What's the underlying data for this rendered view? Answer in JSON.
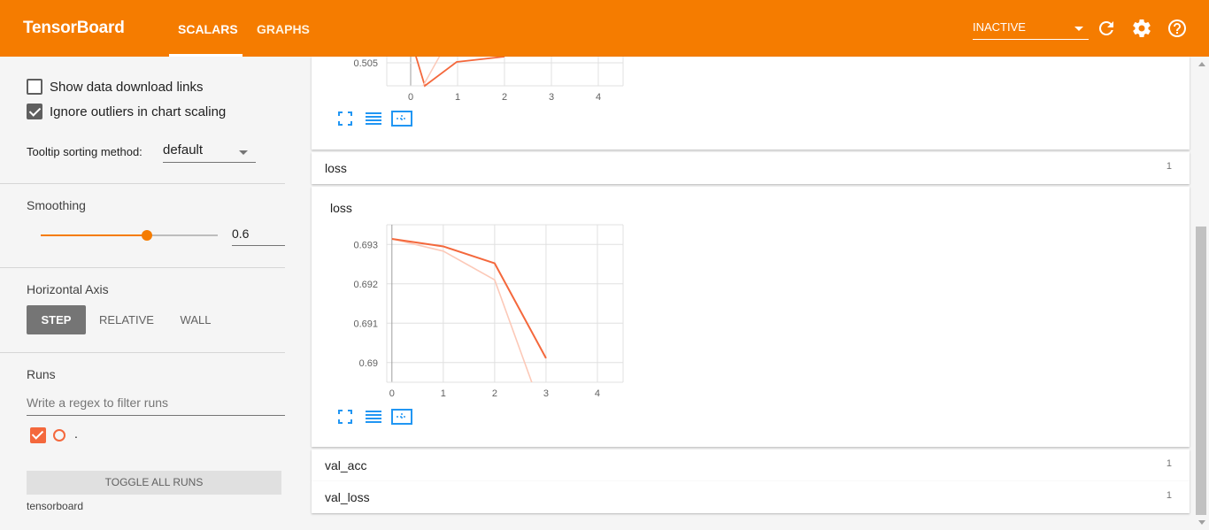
{
  "header": {
    "title": "TensorBoard",
    "tabs": [
      {
        "label": "SCALARS",
        "active": true
      },
      {
        "label": "GRAPHS",
        "active": false
      }
    ],
    "reload_status": "INACTIVE",
    "icons": [
      "refresh-icon",
      "settings-icon",
      "help-icon"
    ],
    "color": "#f57c00"
  },
  "sidebar": {
    "show_download_links": {
      "label": "Show data download links",
      "checked": false
    },
    "ignore_outliers": {
      "label": "Ignore outliers in chart scaling",
      "checked": true
    },
    "tooltip_sorting": {
      "label": "Tooltip sorting method:",
      "value": "default"
    },
    "smoothing": {
      "title": "Smoothing",
      "value": "0.6"
    },
    "horizontal_axis": {
      "title": "Horizontal Axis",
      "options": [
        "STEP",
        "RELATIVE",
        "WALL"
      ],
      "selected": "STEP"
    },
    "runs": {
      "title": "Runs",
      "filter_placeholder": "Write a regex to filter runs",
      "items": [
        {
          "name": ".",
          "checked": true,
          "color": "#f4683c"
        }
      ]
    },
    "toggle_all_label": "TOGGLE ALL RUNS",
    "footer": "tensorboard"
  },
  "main": {
    "acc_chart_fragment": {
      "y_tick": "0.505",
      "x_ticks": [
        "0",
        "1",
        "2",
        "3",
        "4"
      ]
    },
    "categories": [
      {
        "name": "loss",
        "count": "1"
      },
      {
        "name": "val_acc",
        "count": "1"
      },
      {
        "name": "val_loss",
        "count": "1"
      }
    ],
    "loss_chart": {
      "title": "loss"
    }
  },
  "chart_data": {
    "type": "line",
    "title": "loss",
    "x": [
      0,
      1,
      2,
      3
    ],
    "xlim": [
      -0.1,
      4.5
    ],
    "ylim": [
      0.6895,
      0.6935
    ],
    "x_ticks": [
      "0",
      "1",
      "2",
      "3",
      "4"
    ],
    "y_ticks": [
      "0.693",
      "0.692",
      "0.691",
      "0.69"
    ],
    "series": [
      {
        "values": [
          0.69314,
          0.69295,
          0.69252,
          0.69011
        ],
        "color": "#f4683c",
        "kind": "smoothed"
      },
      {
        "values": [
          0.69314,
          0.69283,
          0.6921,
          0.6885
        ],
        "color": "#fcc9b8",
        "kind": "raw"
      }
    ]
  }
}
